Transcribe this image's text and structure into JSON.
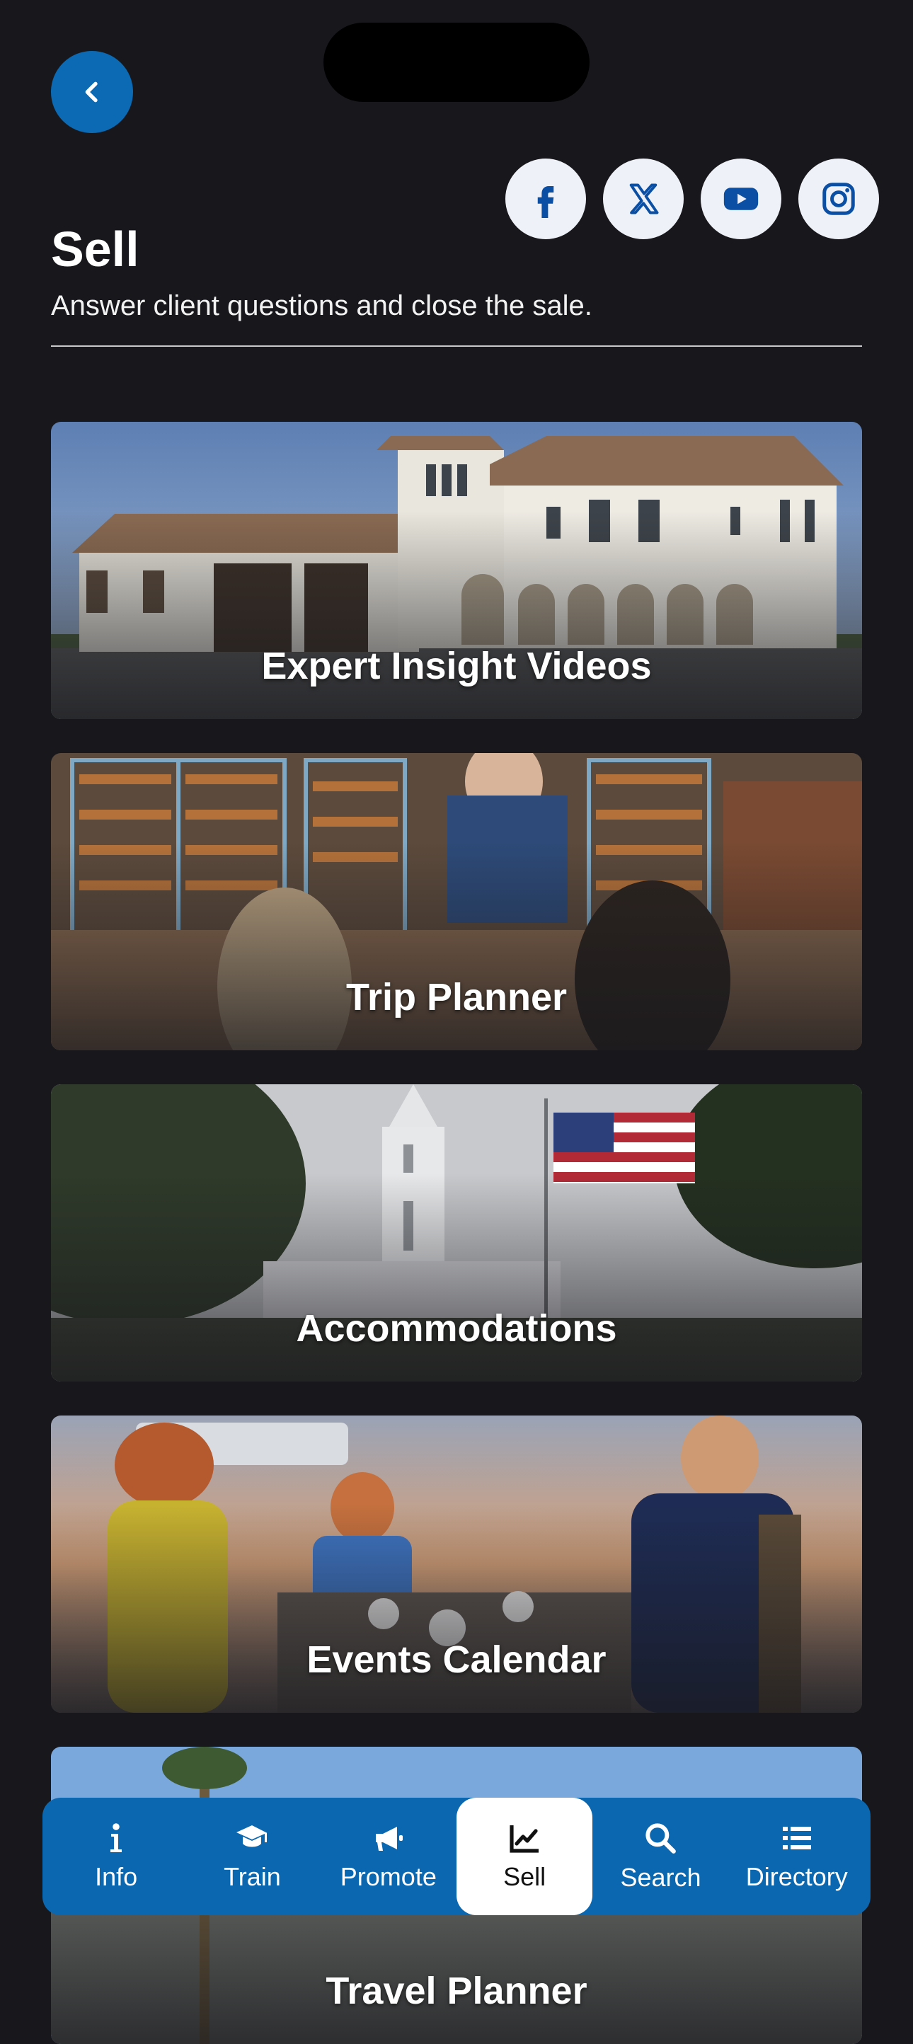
{
  "header": {
    "title": "Sell",
    "subtitle": "Answer client questions and close the sale."
  },
  "social": [
    "facebook-icon",
    "x-icon",
    "youtube-icon",
    "instagram-icon"
  ],
  "cards": [
    {
      "label": "Expert Insight Videos"
    },
    {
      "label": "Trip Planner"
    },
    {
      "label": "Accommodations"
    },
    {
      "label": "Events Calendar"
    },
    {
      "label": "Travel Planner"
    }
  ],
  "tabs": [
    {
      "label": "Info",
      "icon": "info-icon"
    },
    {
      "label": "Train",
      "icon": "graduation-cap-icon"
    },
    {
      "label": "Promote",
      "icon": "megaphone-icon"
    },
    {
      "label": "Sell",
      "icon": "chart-line-icon",
      "active": true
    },
    {
      "label": "Search",
      "icon": "search-icon"
    },
    {
      "label": "Directory",
      "icon": "list-icon"
    }
  ],
  "colors": {
    "accent": "#0a67b0",
    "background": "#18181c"
  }
}
